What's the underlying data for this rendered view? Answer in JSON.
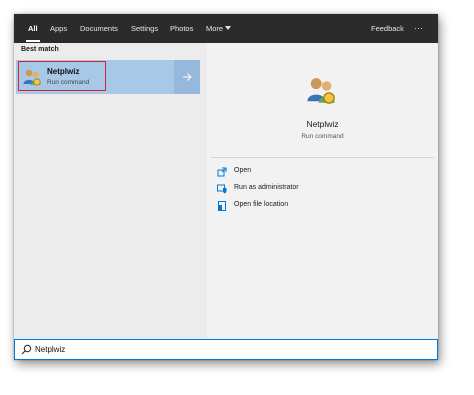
{
  "tabs": [
    {
      "label": "All",
      "active": true
    },
    {
      "label": "Apps"
    },
    {
      "label": "Documents"
    },
    {
      "label": "Settings"
    },
    {
      "label": "Photos"
    },
    {
      "label": "More"
    }
  ],
  "feedback_label": "Feedback",
  "more_options_label": "···",
  "left": {
    "section_header": "Best match",
    "result": {
      "title": "Netplwiz",
      "subtitle": "Run command",
      "icon": "users-icon"
    }
  },
  "detail": {
    "title": "Netplwiz",
    "subtitle": "Run command",
    "icon": "users-icon",
    "actions": [
      {
        "label": "Open",
        "icon": "open-icon"
      },
      {
        "label": "Run as administrator",
        "icon": "shield-admin-icon"
      },
      {
        "label": "Open file location",
        "icon": "file-location-icon"
      }
    ]
  },
  "search": {
    "value": "Netplwiz",
    "icon": "search-icon"
  },
  "colors": {
    "accent": "#0078d7",
    "highlight": "#d3232b",
    "selected": "#a8c8e8",
    "topbar": "#2b2b2b"
  }
}
